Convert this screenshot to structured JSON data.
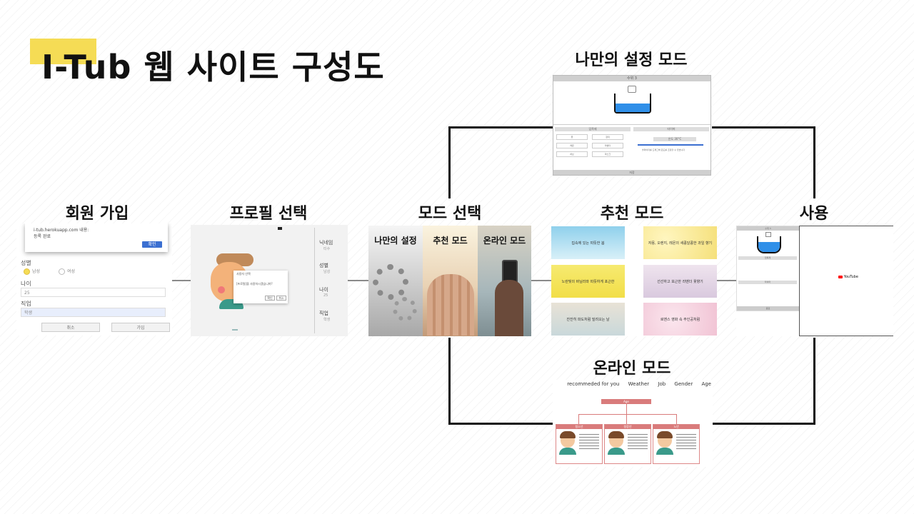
{
  "title": "I-Tub 웹 사이트 구성도",
  "labels": {
    "signup": "회원 가입",
    "profile": "프로필 선택",
    "mode_select": "모드 선택",
    "custom_mode": "나만의 설정 모드",
    "recommend_mode": "추천 모드",
    "use": "사용",
    "online_mode": "온라인 모드"
  },
  "signup": {
    "alert_url": "i-tub.herokuapp.com 내용:",
    "alert_msg": "등록 완료",
    "alert_ok": "확인",
    "gender_label": "성별",
    "male": "남성",
    "female": "여성",
    "age_label": "나이",
    "age_value": "25",
    "job_label": "직업",
    "job_value": "학생",
    "cancel": "취소",
    "join": "가입"
  },
  "profile": {
    "dialog_title": "사용자 선택",
    "dialog_msg": "[프로필]을 사용하시겠습니까?",
    "confirm": "확인",
    "cancel": "취소",
    "side": [
      {
        "label": "닉네임",
        "value": "티수"
      },
      {
        "label": "성별",
        "value": "남성"
      },
      {
        "label": "나이",
        "value": "25"
      },
      {
        "label": "직업",
        "value": "학생"
      }
    ]
  },
  "modes": [
    "나만의 설정",
    "추천 모드",
    "온라인 모드"
  ],
  "custom": {
    "header": "수위 3",
    "left_tab": "입욕제",
    "right_tab": "타이머",
    "temp": "온도 30°C",
    "items": [
      "꽃",
      "장미",
      "레몬",
      "라벤더",
      "허브",
      "마스크"
    ],
    "hint": "슬라이더를 드래그해 온도를 조정할 수 있습니다",
    "save": "저장"
  },
  "recommend": {
    "tiles": [
      "집속에 있는 따뜻한 봄",
      "자몽, 오렌지, 레몬의 새콤달콤한 과일 향기",
      "노란빛의 바닐라와 따뜻하게 포근한",
      "선선하고 포근한 라벤더 꽃향기",
      "잔잔히 파도처럼 밀려오는 날",
      "로맨스 영화 속 주인공처럼"
    ]
  },
  "use": {
    "header": "수위 3",
    "tab": "입욕제",
    "timer": "타이머",
    "save": "종료",
    "video_brand": "YouTube"
  },
  "online": {
    "nav": [
      "recommeded for you",
      "Weather",
      "Job",
      "Gender",
      "Age"
    ],
    "root": "Age",
    "groups": [
      "청소년",
      "청장년",
      "노년"
    ]
  },
  "colors": {
    "accent": "#f5dc55",
    "water": "#2f8fe8",
    "youtube": "#ff0000",
    "online_red": "#d97b7b"
  }
}
